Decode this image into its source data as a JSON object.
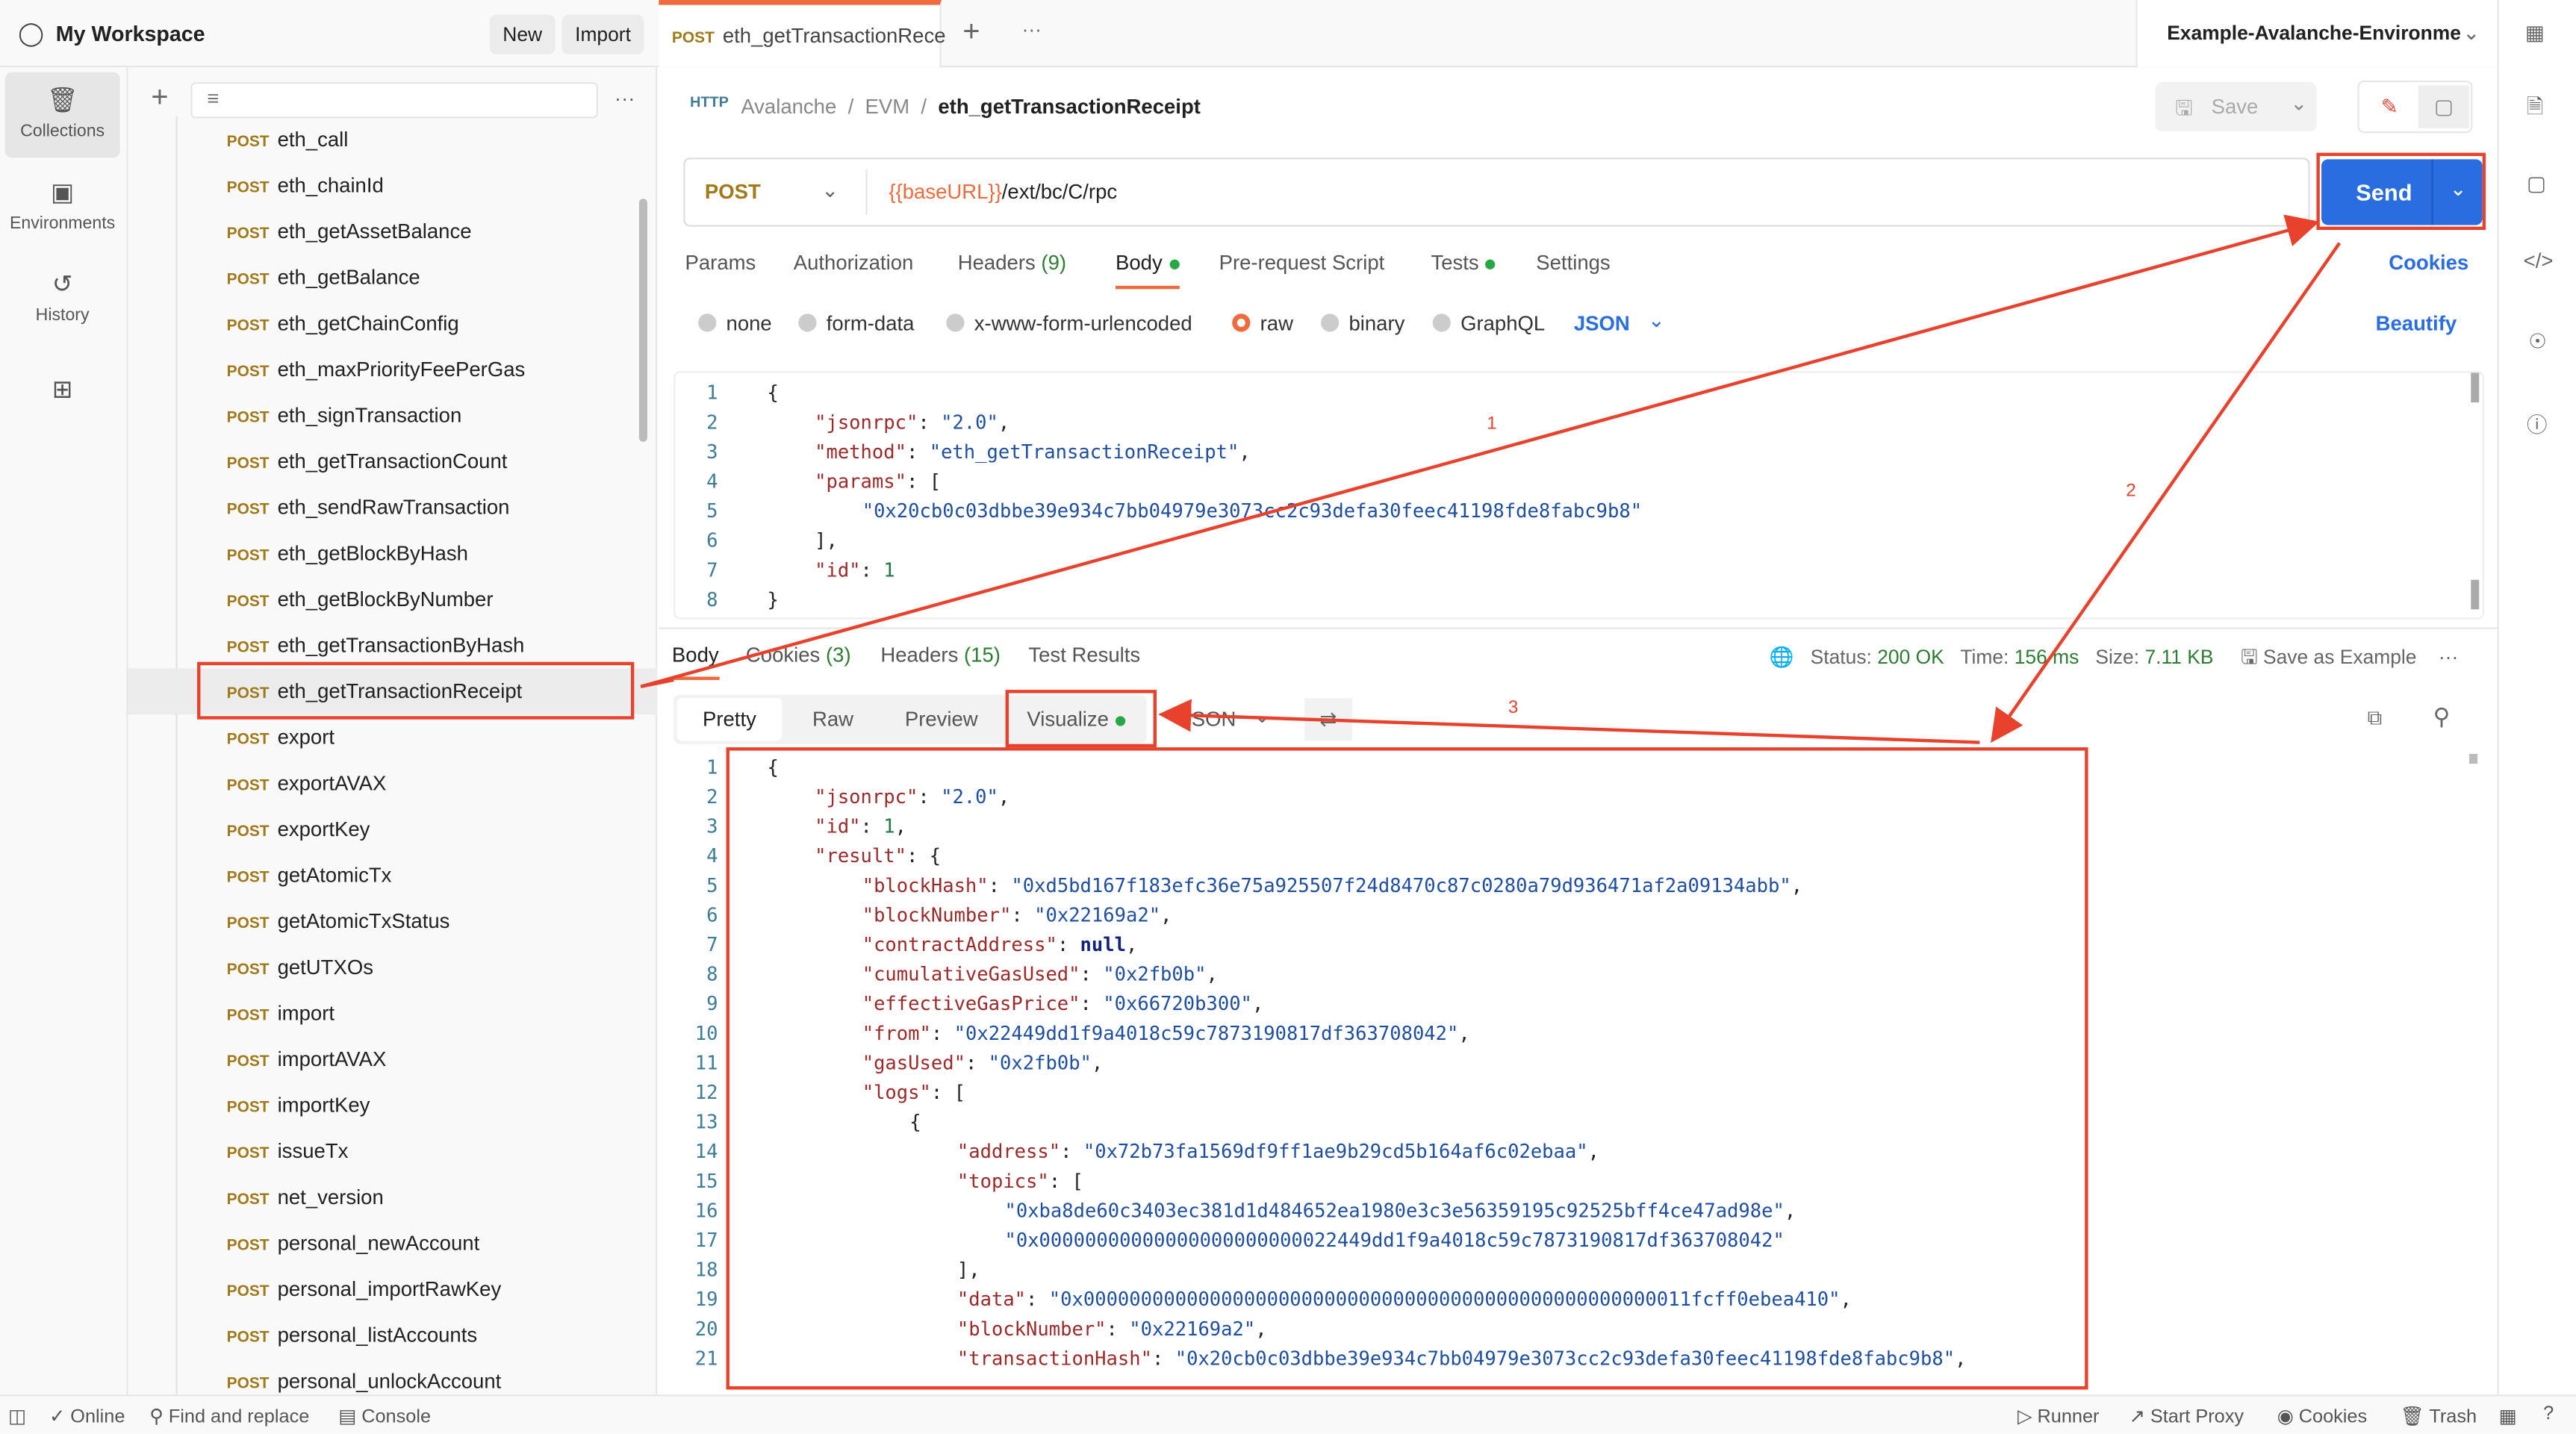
{
  "workspace": {
    "title": "My Workspace",
    "new_label": "New",
    "import_label": "Import"
  },
  "tabs": [
    {
      "method": "POST",
      "label": "eth_getTransactionRece"
    }
  ],
  "environment": "Example-Avalanche-Environme",
  "rail": [
    {
      "label": "Collections",
      "icon": "collections-icon"
    },
    {
      "label": "Environments",
      "icon": "environments-icon"
    },
    {
      "label": "History",
      "icon": "history-icon"
    },
    {
      "label": "",
      "icon": "apps-icon"
    }
  ],
  "sidebar": {
    "method": "POST",
    "selected_index": 12,
    "items": [
      "eth_call",
      "eth_chainId",
      "eth_getAssetBalance",
      "eth_getBalance",
      "eth_getChainConfig",
      "eth_maxPriorityFeePerGas",
      "eth_signTransaction",
      "eth_getTransactionCount",
      "eth_sendRawTransaction",
      "eth_getBlockByHash",
      "eth_getBlockByNumber",
      "eth_getTransactionByHash",
      "eth_getTransactionReceipt",
      "export",
      "exportAVAX",
      "exportKey",
      "getAtomicTx",
      "getAtomicTxStatus",
      "getUTXOs",
      "import",
      "importAVAX",
      "importKey",
      "issueTx",
      "net_version",
      "personal_newAccount",
      "personal_importRawKey",
      "personal_listAccounts",
      "personal_unlockAccount"
    ]
  },
  "breadcrumb": {
    "icon_text": "HTTP",
    "parts": [
      "Avalanche",
      "EVM"
    ],
    "current": "eth_getTransactionReceipt",
    "save_label": "Save"
  },
  "request": {
    "method": "POST",
    "url_var": "{{baseURL}}",
    "url_path": "/ext/bc/C/rpc",
    "send_label": "Send"
  },
  "req_tabs": [
    {
      "label": "Params"
    },
    {
      "label": "Authorization"
    },
    {
      "label": "Headers",
      "count": "(9)"
    },
    {
      "label": "Body",
      "dot": true,
      "active": true
    },
    {
      "label": "Pre-request Script"
    },
    {
      "label": "Tests",
      "dot": true
    },
    {
      "label": "Settings"
    }
  ],
  "cookies_label": "Cookies",
  "body_types": [
    {
      "label": "none"
    },
    {
      "label": "form-data"
    },
    {
      "label": "x-www-form-urlencoded"
    },
    {
      "label": "raw",
      "selected": true
    },
    {
      "label": "binary"
    },
    {
      "label": "GraphQL"
    }
  ],
  "body_format": "JSON",
  "beautify_label": "Beautify",
  "request_body": [
    [
      0,
      [
        "p",
        "{"
      ]
    ],
    [
      1,
      [
        "k",
        "\"jsonrpc\""
      ],
      [
        "p",
        ": "
      ],
      [
        "s",
        "\"2.0\""
      ],
      [
        "p",
        ","
      ]
    ],
    [
      1,
      [
        "k",
        "\"method\""
      ],
      [
        "p",
        ": "
      ],
      [
        "s",
        "\"eth_getTransactionReceipt\""
      ],
      [
        "p",
        ","
      ]
    ],
    [
      1,
      [
        "k",
        "\"params\""
      ],
      [
        "p",
        ": ["
      ]
    ],
    [
      2,
      [
        "s",
        "\"0x20cb0c03dbbe39e934c7bb04979e3073cc2c93defa30feec41198fde8fabc9b8\""
      ]
    ],
    [
      1,
      [
        "p",
        "],"
      ]
    ],
    [
      1,
      [
        "k",
        "\"id\""
      ],
      [
        "p",
        ": "
      ],
      [
        "n",
        "1"
      ]
    ],
    [
      0,
      [
        "p",
        "}"
      ]
    ]
  ],
  "resp_tabs": [
    {
      "label": "Body",
      "active": true
    },
    {
      "label": "Cookies",
      "count": "(3)"
    },
    {
      "label": "Headers",
      "count": "(15)"
    },
    {
      "label": "Test Results"
    }
  ],
  "status": {
    "status_label": "Status:",
    "status": "200 OK",
    "time_label": "Time:",
    "time": "156 ms",
    "size_label": "Size:",
    "size": "7.11 KB",
    "save_example": "Save as Example",
    "color": "#2e7d32"
  },
  "view_modes": [
    {
      "label": "Pretty",
      "active": true
    },
    {
      "label": "Raw"
    },
    {
      "label": "Preview"
    },
    {
      "label": "Visualize",
      "dot": true
    }
  ],
  "resp_format": "JSON",
  "response_body": [
    [
      0,
      [
        "p",
        "{"
      ]
    ],
    [
      1,
      [
        "k",
        "\"jsonrpc\""
      ],
      [
        "p",
        ": "
      ],
      [
        "s",
        "\"2.0\""
      ],
      [
        "p",
        ","
      ]
    ],
    [
      1,
      [
        "k",
        "\"id\""
      ],
      [
        "p",
        ": "
      ],
      [
        "n",
        "1"
      ],
      [
        "p",
        ","
      ]
    ],
    [
      1,
      [
        "k",
        "\"result\""
      ],
      [
        "p",
        ": {"
      ]
    ],
    [
      2,
      [
        "k",
        "\"blockHash\""
      ],
      [
        "p",
        ": "
      ],
      [
        "s",
        "\"0xd5bd167f183efc36e75a925507f24d8470c87c0280a79d936471af2a09134abb\""
      ],
      [
        "p",
        ","
      ]
    ],
    [
      2,
      [
        "k",
        "\"blockNumber\""
      ],
      [
        "p",
        ": "
      ],
      [
        "s",
        "\"0x22169a2\""
      ],
      [
        "p",
        ","
      ]
    ],
    [
      2,
      [
        "k",
        "\"contractAddress\""
      ],
      [
        "p",
        ": "
      ],
      [
        "b",
        "null"
      ],
      [
        "p",
        ","
      ]
    ],
    [
      2,
      [
        "k",
        "\"cumulativeGasUsed\""
      ],
      [
        "p",
        ": "
      ],
      [
        "s",
        "\"0x2fb0b\""
      ],
      [
        "p",
        ","
      ]
    ],
    [
      2,
      [
        "k",
        "\"effectiveGasPrice\""
      ],
      [
        "p",
        ": "
      ],
      [
        "s",
        "\"0x66720b300\""
      ],
      [
        "p",
        ","
      ]
    ],
    [
      2,
      [
        "k",
        "\"from\""
      ],
      [
        "p",
        ": "
      ],
      [
        "s",
        "\"0x22449dd1f9a4018c59c7873190817df363708042\""
      ],
      [
        "p",
        ","
      ]
    ],
    [
      2,
      [
        "k",
        "\"gasUsed\""
      ],
      [
        "p",
        ": "
      ],
      [
        "s",
        "\"0x2fb0b\""
      ],
      [
        "p",
        ","
      ]
    ],
    [
      2,
      [
        "k",
        "\"logs\""
      ],
      [
        "p",
        ": ["
      ]
    ],
    [
      3,
      [
        "p",
        "{"
      ]
    ],
    [
      4,
      [
        "k",
        "\"address\""
      ],
      [
        "p",
        ": "
      ],
      [
        "s",
        "\"0x72b73fa1569df9ff1ae9b29cd5b164af6c02ebaa\""
      ],
      [
        "p",
        ","
      ]
    ],
    [
      4,
      [
        "k",
        "\"topics\""
      ],
      [
        "p",
        ": ["
      ]
    ],
    [
      5,
      [
        "s",
        "\"0xba8de60c3403ec381d1d484652ea1980e3c3e56359195c92525bff4ce47ad98e\""
      ],
      [
        "p",
        ","
      ]
    ],
    [
      5,
      [
        "s",
        "\"0x00000000000000000000000022449dd1f9a4018c59c7873190817df363708042\""
      ]
    ],
    [
      4,
      [
        "p",
        "],"
      ]
    ],
    [
      4,
      [
        "k",
        "\"data\""
      ],
      [
        "p",
        ": "
      ],
      [
        "s",
        "\"0x00000000000000000000000000000000000000000000000000011fcff0ebea410\""
      ],
      [
        "p",
        ","
      ]
    ],
    [
      4,
      [
        "k",
        "\"blockNumber\""
      ],
      [
        "p",
        ": "
      ],
      [
        "s",
        "\"0x22169a2\""
      ],
      [
        "p",
        ","
      ]
    ],
    [
      4,
      [
        "k",
        "\"transactionHash\""
      ],
      [
        "p",
        ": "
      ],
      [
        "s",
        "\"0x20cb0c03dbbe39e934c7bb04979e3073cc2c93defa30feec41198fde8fabc9b8\""
      ],
      [
        "p",
        ","
      ]
    ]
  ],
  "statusbar": {
    "left": [
      "Online",
      "Find and replace",
      "Console"
    ],
    "right": [
      "Runner",
      "Start Proxy",
      "Cookies",
      "Trash"
    ]
  },
  "annotations": {
    "labels": [
      "1",
      "2",
      "3"
    ],
    "color": "#e8412c"
  }
}
